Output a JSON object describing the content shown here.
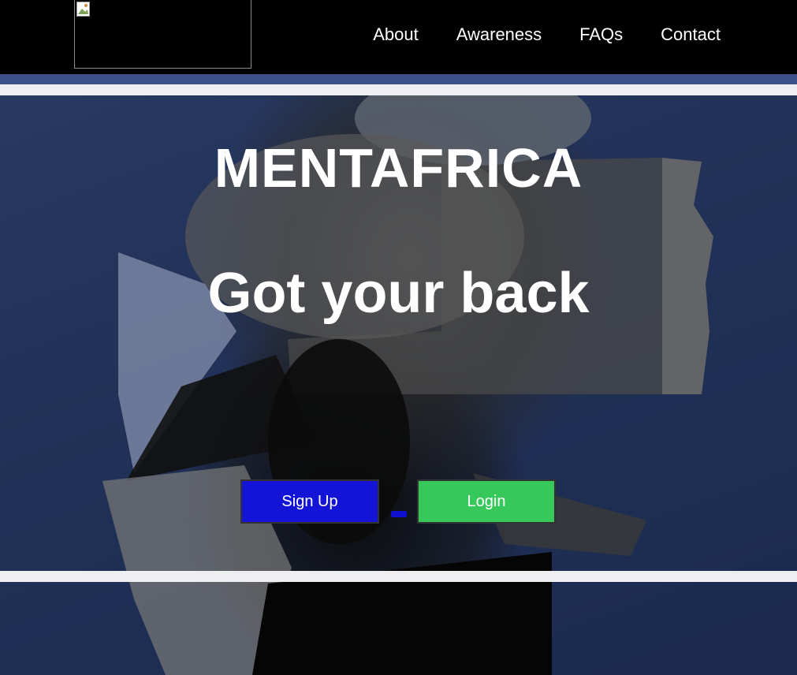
{
  "nav": {
    "logo_alt": "",
    "links": [
      "About",
      "Awareness",
      "FAQs",
      "Contact"
    ]
  },
  "hero": {
    "title": "MENTAFRICA",
    "subtitle": "Got your back"
  },
  "buttons": {
    "signup": "Sign Up",
    "login": "Login"
  },
  "colors": {
    "navbar_bg": "#000000",
    "hero_bg": "#223258",
    "signup_bg": "#1414d6",
    "login_bg": "#36c85b"
  }
}
